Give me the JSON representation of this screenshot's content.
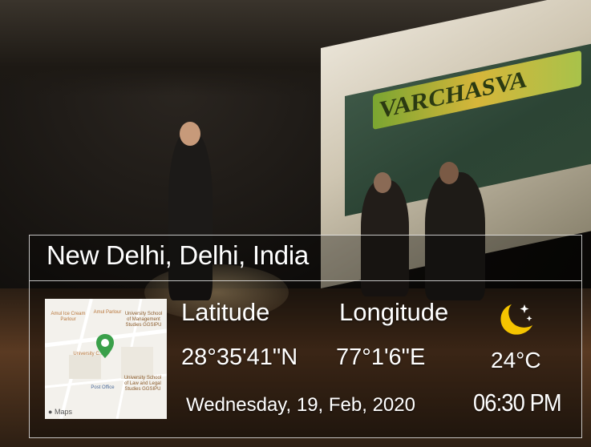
{
  "location": "New Delhi, Delhi, India",
  "coordinates": {
    "latitude_label": "Latitude",
    "longitude_label": "Longitude",
    "latitude": "28°35'41\"N",
    "longitude": "77°1'6\"E"
  },
  "weather": {
    "icon": "crescent-moon-icon",
    "temperature": "24°C"
  },
  "datetime": {
    "date": "Wednesday, 19, Feb, 2020",
    "time": "06:30 PM"
  },
  "map": {
    "attribution": "Maps",
    "labels": {
      "ice_cream": "Amul Ice Cream Parlour",
      "parlour": "Amul Parlour",
      "mgmt": "University School of Management Studies GGSIPU",
      "university": "University C...",
      "post_office": "Post Office",
      "law": "University School of Law and Legal Studies GGSIPU"
    },
    "pin_color": "#3aa04a"
  },
  "scene_text": {
    "title": "VARCHASVA"
  }
}
